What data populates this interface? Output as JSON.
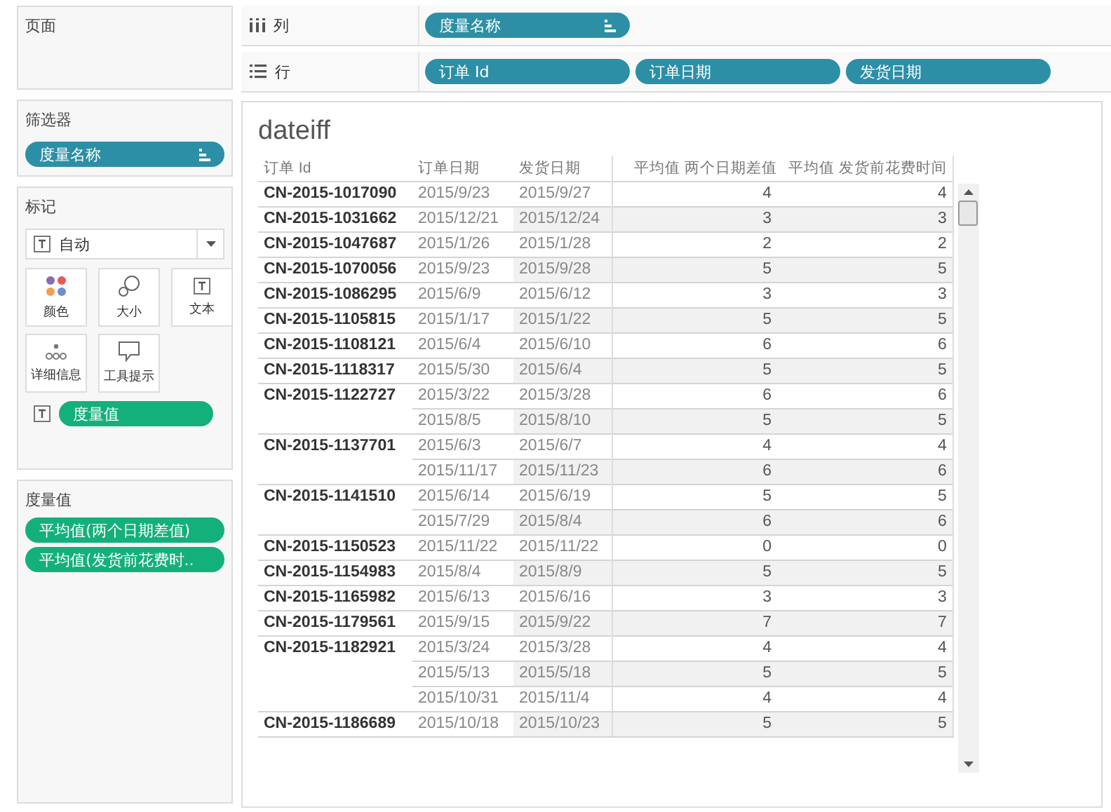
{
  "pages_card": {
    "title": "页面"
  },
  "filters_card": {
    "title": "筛选器",
    "pills": [
      {
        "text": "度量名称",
        "sort_icon": true
      }
    ]
  },
  "marks_card": {
    "title": "标记",
    "mark_type": "自动",
    "buttons": [
      {
        "label": "颜色",
        "kind": "color"
      },
      {
        "label": "大小",
        "kind": "size"
      },
      {
        "label": "文本",
        "kind": "text"
      },
      {
        "label": "详细信息",
        "kind": "detail"
      },
      {
        "label": "工具提示",
        "kind": "tooltip"
      }
    ],
    "fields": [
      {
        "text": "度量值",
        "kind": "text"
      }
    ]
  },
  "measure_values_card": {
    "title": "度量值",
    "pills": [
      {
        "text": "平均值(两个日期差值)"
      },
      {
        "text": "平均值(发货前花费时.."
      }
    ]
  },
  "shelves": [
    {
      "label": "列",
      "kind": "columns",
      "pills": [
        {
          "text": "度量名称",
          "sort_icon": true
        }
      ]
    },
    {
      "label": "行",
      "kind": "rows",
      "pills": [
        {
          "text": "订单 Id",
          "sort_icon": false
        },
        {
          "text": "订单日期",
          "sort_icon": false
        },
        {
          "text": "发货日期",
          "sort_icon": false
        }
      ]
    }
  ],
  "view": {
    "title": "dateiff",
    "columns": [
      "订单 Id",
      "订单日期",
      "发货日期",
      "平均值 两个日期差值",
      "平均值 发货前花费时间"
    ],
    "orders": [
      {
        "id": "CN-2015-1017090",
        "lines": [
          [
            "2015/9/23",
            "2015/9/27",
            "4",
            "4"
          ]
        ]
      },
      {
        "id": "CN-2015-1031662",
        "lines": [
          [
            "2015/12/21",
            "2015/12/24",
            "3",
            "3"
          ]
        ]
      },
      {
        "id": "CN-2015-1047687",
        "lines": [
          [
            "2015/1/26",
            "2015/1/28",
            "2",
            "2"
          ]
        ]
      },
      {
        "id": "CN-2015-1070056",
        "lines": [
          [
            "2015/9/23",
            "2015/9/28",
            "5",
            "5"
          ]
        ]
      },
      {
        "id": "CN-2015-1086295",
        "lines": [
          [
            "2015/6/9",
            "2015/6/12",
            "3",
            "3"
          ]
        ]
      },
      {
        "id": "CN-2015-1105815",
        "lines": [
          [
            "2015/1/17",
            "2015/1/22",
            "5",
            "5"
          ]
        ]
      },
      {
        "id": "CN-2015-1108121",
        "lines": [
          [
            "2015/6/4",
            "2015/6/10",
            "6",
            "6"
          ]
        ]
      },
      {
        "id": "CN-2015-1118317",
        "lines": [
          [
            "2015/5/30",
            "2015/6/4",
            "5",
            "5"
          ]
        ]
      },
      {
        "id": "CN-2015-1122727",
        "lines": [
          [
            "2015/3/22",
            "2015/3/28",
            "6",
            "6"
          ],
          [
            "2015/8/5",
            "2015/8/10",
            "5",
            "5"
          ]
        ]
      },
      {
        "id": "CN-2015-1137701",
        "lines": [
          [
            "2015/6/3",
            "2015/6/7",
            "4",
            "4"
          ],
          [
            "2015/11/17",
            "2015/11/23",
            "6",
            "6"
          ]
        ]
      },
      {
        "id": "CN-2015-1141510",
        "lines": [
          [
            "2015/6/14",
            "2015/6/19",
            "5",
            "5"
          ],
          [
            "2015/7/29",
            "2015/8/4",
            "6",
            "6"
          ]
        ]
      },
      {
        "id": "CN-2015-1150523",
        "lines": [
          [
            "2015/11/22",
            "2015/11/22",
            "0",
            "0"
          ]
        ]
      },
      {
        "id": "CN-2015-1154983",
        "lines": [
          [
            "2015/8/4",
            "2015/8/9",
            "5",
            "5"
          ]
        ]
      },
      {
        "id": "CN-2015-1165982",
        "lines": [
          [
            "2015/6/13",
            "2015/6/16",
            "3",
            "3"
          ]
        ]
      },
      {
        "id": "CN-2015-1179561",
        "lines": [
          [
            "2015/9/15",
            "2015/9/22",
            "7",
            "7"
          ]
        ]
      },
      {
        "id": "CN-2015-1182921",
        "lines": [
          [
            "2015/3/24",
            "2015/3/28",
            "4",
            "4"
          ],
          [
            "2015/5/13",
            "2015/5/18",
            "5",
            "5"
          ],
          [
            "2015/10/31",
            "2015/11/4",
            "4",
            "4"
          ]
        ]
      },
      {
        "id": "CN-2015-1186689",
        "lines": [
          [
            "2015/10/18",
            "2015/10/23",
            "5",
            "5"
          ]
        ]
      }
    ]
  }
}
